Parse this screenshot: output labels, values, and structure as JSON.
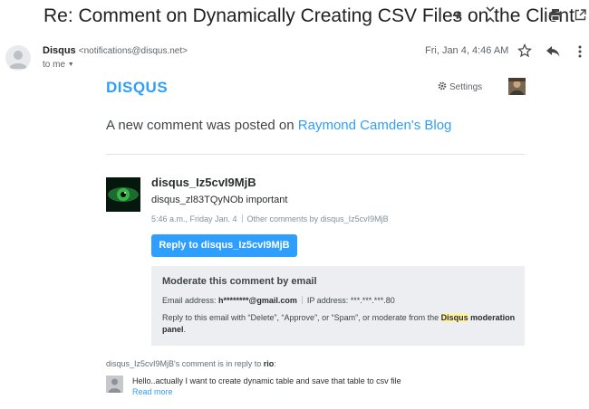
{
  "subject": "Re: Comment on Dynamically Creating CSV Files on the Client",
  "toolbar": {
    "move_icon": "arrow-right-icon",
    "expand_icon": "expand-collapse-icon",
    "print_icon": "print-icon",
    "popout_icon": "open-in-new-icon"
  },
  "message": {
    "sender_name": "Disqus",
    "sender_email": "<notifications@disqus.net>",
    "to_label": "to me",
    "date": "Fri, Jan 4, 4:46 AM",
    "star_icon": "star-outline-icon",
    "reply_icon": "reply-icon",
    "more_icon": "more-vertical-icon"
  },
  "email": {
    "logo": "DISQUS",
    "settings_label": "Settings",
    "settings_icon": "gear-icon",
    "intro_prefix": "A new comment was posted on ",
    "intro_link": "Raymond Camden's Blog",
    "comment": {
      "author": "disqus_Iz5cvI9MjB",
      "text": "disqus_zl83TQyNOb important",
      "time": "5:46 a.m., Friday Jan. 4",
      "other_comments": "Other comments by disqus_Iz5cvI9MjB",
      "reply_button": "Reply to disqus_Iz5cvI9MjB"
    },
    "moderate": {
      "title": "Moderate this comment by email",
      "email_label": "Email address: ",
      "email_value": "h********@gmail.com",
      "ip_label": "IP address: ",
      "ip_value": "***.***.***.80",
      "reply_prefix": "Reply to this email with “Delete”, “Approve”, or “Spam”, or moderate from the ",
      "reply_link_disqus": "Disqus",
      "reply_link_rest": " moderation panel",
      "reply_suffix": "."
    },
    "in_reply": {
      "prefix": "disqus_Iz5cvI9MjB's comment is in reply to ",
      "user": "rio",
      "suffix": ":"
    },
    "parent_comment": {
      "text": "Hello..actually I want to create dynamic table and save that table to csv file",
      "read_more": "Read more"
    }
  },
  "colors": {
    "disqus_blue": "#2e9fff",
    "highlight": "#fff2a8",
    "moderate_bg": "#eceef1"
  }
}
